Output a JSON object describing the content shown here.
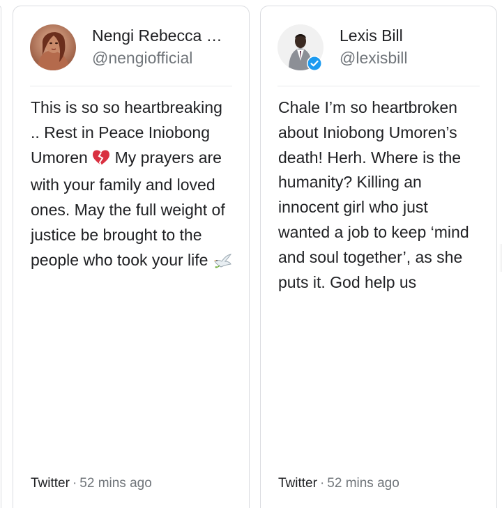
{
  "feed": {
    "source": "Twitter",
    "separator": "·",
    "timestamp": "52 mins ago",
    "cards": [
      {
        "display_name": "Nengi Rebecca Ha...",
        "handle": "@nengiofficial",
        "verified": false,
        "text_parts": [
          "This is so so heartbreaking .. Rest in Peace Iniobong Umoren ",
          " My prayers are with your family and loved ones. May the full weight of justice be brought to the people who took your life "
        ],
        "emojis": [
          "broken-heart-icon",
          "dove-icon"
        ]
      },
      {
        "display_name": "Lexis Bill",
        "handle": "@lexisbill",
        "verified": true,
        "text": "Chale I’m so heartbroken about Iniobong Umoren’s death! Herh. Where is the humanity? Killing an innocent girl who just wanted a job to keep ‘mind and soul together’, as she puts it. God help us"
      }
    ]
  },
  "colors": {
    "text_primary": "#202124",
    "text_secondary": "#70757a",
    "border": "#dadce0",
    "verified_badge": "#1d9bf0",
    "broken_heart": "#d93040"
  }
}
